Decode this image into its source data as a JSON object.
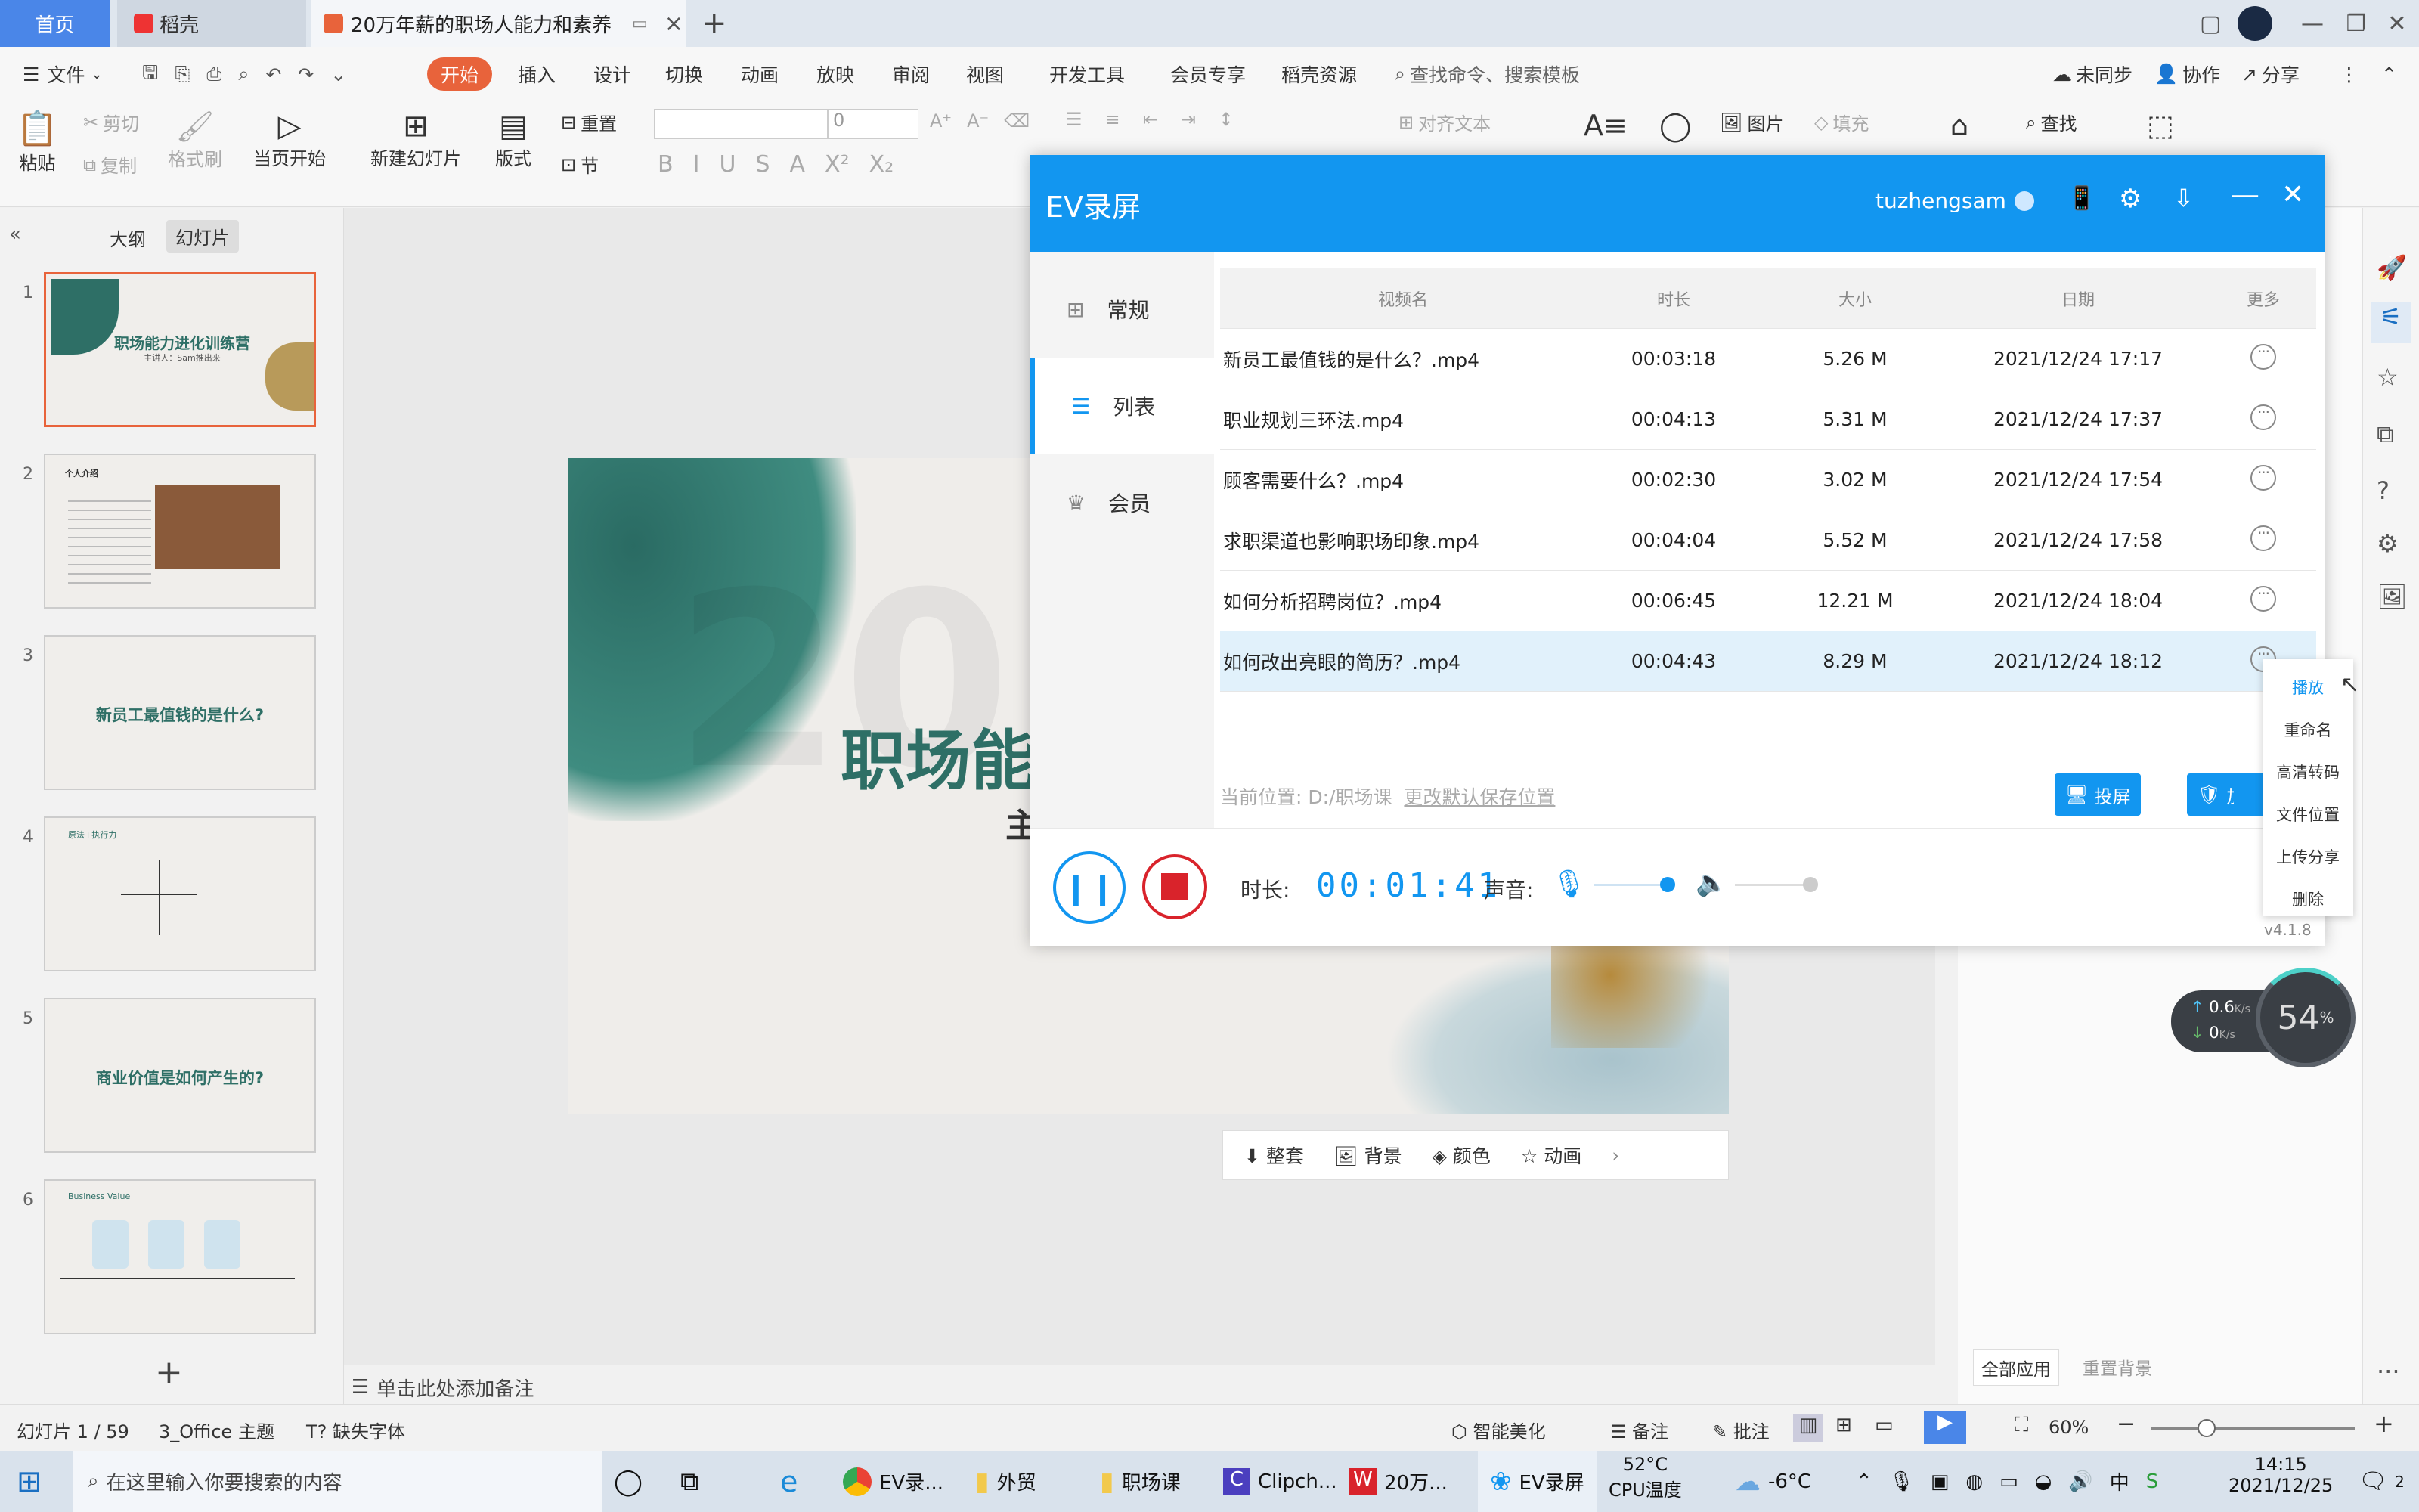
{
  "tabs": {
    "home": "首页",
    "docer": "稻壳",
    "doc": "20万年薪的职场人能力和素养"
  },
  "menu": {
    "file": "文件",
    "items": [
      "开始",
      "插入",
      "设计",
      "切换",
      "动画",
      "放映",
      "审阅",
      "视图",
      "开发工具",
      "会员专享",
      "稻壳资源"
    ],
    "search": "查找命令、搜索模板",
    "unsync": "未同步",
    "collab": "协作",
    "share": "分享"
  },
  "toolbar": {
    "paste": "粘贴",
    "cut": "剪切",
    "copy": "复制",
    "format_painter": "格式刷",
    "from_current": "当页开始",
    "new_slide": "新建幻灯片",
    "layout": "版式",
    "reset": "重置",
    "section": "节",
    "font_size": "0",
    "align_text": "对齐文本",
    "picture": "图片",
    "fill": "填充",
    "find": "查找"
  },
  "leftpanel": {
    "outline": "大纲",
    "slides": "幻灯片",
    "thumbs": [
      {
        "num": "1",
        "title": "职场能力进化训练营",
        "sub": "主讲人：Sam推出来"
      },
      {
        "num": "2",
        "title": "个人介绍"
      },
      {
        "num": "3",
        "title": "新员工最值钱的是什么?"
      },
      {
        "num": "4",
        "title": "原法+执行力"
      },
      {
        "num": "5",
        "title": "商业价值是如何产生的?"
      },
      {
        "num": "6",
        "title": "Business Value"
      }
    ]
  },
  "slide": {
    "title": "职场能",
    "sub": "主",
    "bg_year": "202"
  },
  "slide_toolbar": {
    "items": [
      "整套",
      "背景",
      "颜色",
      "动画"
    ]
  },
  "notes": "单击此处添加备注",
  "ev": {
    "title": "EV录屏",
    "user": "tuzhengsam",
    "nav": [
      {
        "label": "常规"
      },
      {
        "label": "列表"
      },
      {
        "label": "会员"
      }
    ],
    "columns": [
      "视频名",
      "时长",
      "大小",
      "日期",
      "更多"
    ],
    "rows": [
      {
        "name": "新员工最值钱的是什么？.mp4",
        "dur": "00:03:18",
        "size": "5.26 M",
        "date": "2021/12/24 17:17"
      },
      {
        "name": "职业规划三环法.mp4",
        "dur": "00:04:13",
        "size": "5.31 M",
        "date": "2021/12/24 17:37"
      },
      {
        "name": "顾客需要什么？.mp4",
        "dur": "00:02:30",
        "size": "3.02 M",
        "date": "2021/12/24 17:54"
      },
      {
        "name": "求职渠道也影响职场印象.mp4",
        "dur": "00:04:04",
        "size": "5.52 M",
        "date": "2021/12/24 17:58"
      },
      {
        "name": "如何分析招聘岗位？.mp4",
        "dur": "00:06:45",
        "size": "12.21 M",
        "date": "2021/12/24 18:04"
      },
      {
        "name": "如何改出亮眼的简历？.mp4",
        "dur": "00:04:43",
        "size": "8.29 M",
        "date": "2021/12/24 18:12"
      }
    ],
    "location_label": "当前位置: D:/职场课",
    "change_location": "更改默认保存位置",
    "cast": "投屏",
    "encrypt": "加密",
    "duration_label": "时长:",
    "duration": "00:01:41",
    "sound_label": "声音:",
    "version": "v4.1.8"
  },
  "context_menu": [
    "播放",
    "重命名",
    "高清转码",
    "文件位置",
    "上传分享",
    "删除"
  ],
  "netspeed": {
    "up": "0.6",
    "down": "0",
    "unit": "K/s",
    "cpu": "54",
    "pct": "%"
  },
  "rightpanel": {
    "apply_all": "全部应用",
    "reset_bg": "重置背景"
  },
  "statusbar": {
    "slide": "幻灯片 1 / 59",
    "theme": "3_Office 主题",
    "missing_font": "缺失字体",
    "beautify": "智能美化",
    "notes": "备注",
    "comment": "批注",
    "zoom": "60%"
  },
  "taskbar": {
    "search": "在这里输入你要搜索的内容",
    "apps": [
      "EV录...",
      "外贸",
      "职场课",
      "Clipch...",
      "20万...",
      "EV录屏"
    ],
    "temp": "52°C",
    "temp_label": "CPU温度",
    "weather": "-6°C",
    "ime": "中",
    "time": "14:15",
    "date": "2021/12/25",
    "notif": "2"
  }
}
